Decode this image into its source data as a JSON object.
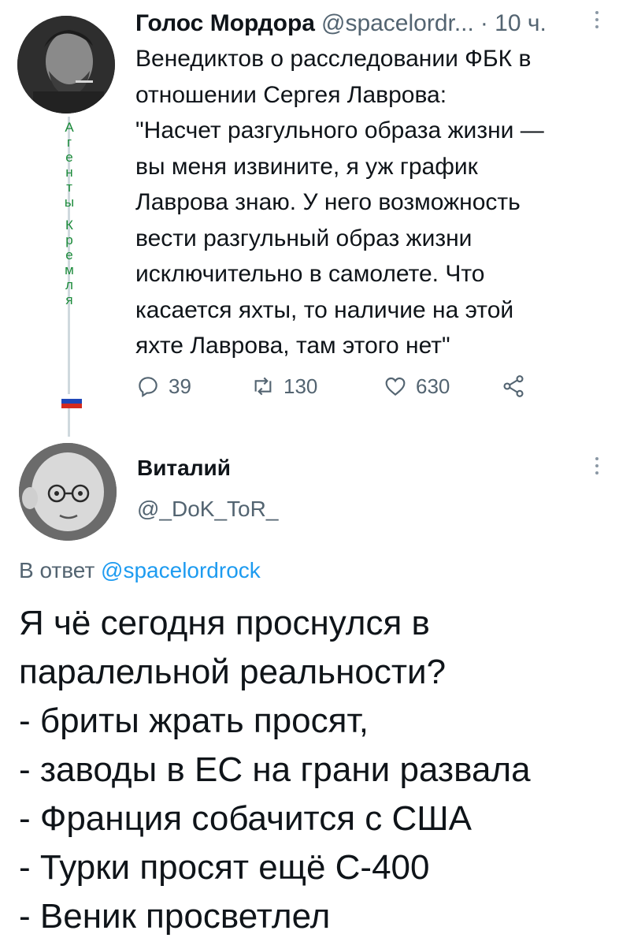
{
  "tweet1": {
    "author_name": "Голос Мордора",
    "author_handle": "@spacelordr...",
    "time": "· 10 ч.",
    "vertical_tag": [
      "А",
      "г",
      "е",
      "н",
      "т",
      "ы",
      "",
      "К",
      "р",
      "е",
      "м",
      "л",
      "я"
    ],
    "body_lines": [
      "Венедиктов о расследовании ФБК в",
      "отношении Сергея Лаврова:",
      "\"Насчет разгульного образа жизни —",
      "вы меня извините, я уж график",
      "Лаврова знаю. У него возможность",
      "вести разгульный образ жизни",
      "исключительно в самолете. Что",
      "касается яхты, то наличие на этой",
      "яхте Лаврова, там этого нет\""
    ],
    "actions": {
      "reply_count": "39",
      "retweet_count": "130",
      "like_count": "630"
    },
    "icons": {
      "reply": "reply-icon",
      "retweet": "retweet-icon",
      "like": "heart-icon",
      "share": "share-icon",
      "more": "more-icon"
    },
    "flag_colors": [
      "#ffffff",
      "#1f47b8",
      "#d52b1e"
    ]
  },
  "tweet2": {
    "author_name": "Виталий",
    "author_handle": "@_DoK_ToR_",
    "reply_prefix": "В ответ",
    "reply_link": "@spacelordrock",
    "body_lines": [
      "Я чё сегодня проснулся в",
      "паралельной реальности?",
      "- бриты жрать просят,",
      "- заводы в ЕС на грани развала",
      "- Франция собачится с США",
      "- Турки просят ещё С-400",
      "- Веник просветлел"
    ]
  },
  "colors": {
    "text": "#0f1419",
    "secondary": "#536471",
    "link": "#1d9bf0",
    "vertical_tag": "#1b8a3a"
  }
}
